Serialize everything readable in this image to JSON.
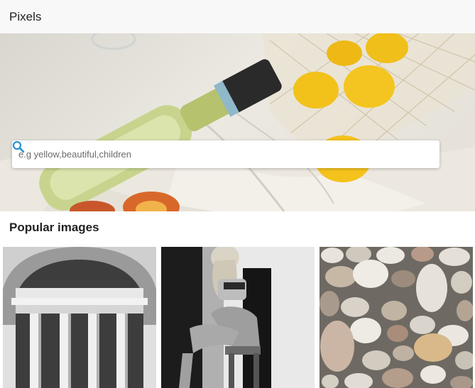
{
  "app_bar": {
    "title": "Pixels"
  },
  "search": {
    "placeholder": "e.g yellow,beautiful,children",
    "icon": "search-icon",
    "accent_color": "#2b8fd6"
  },
  "popular": {
    "title": "Popular images",
    "images": [
      {
        "subject": "classical building with columns"
      },
      {
        "subject": "woman sitting on chair"
      },
      {
        "subject": "pebble stones"
      }
    ]
  }
}
